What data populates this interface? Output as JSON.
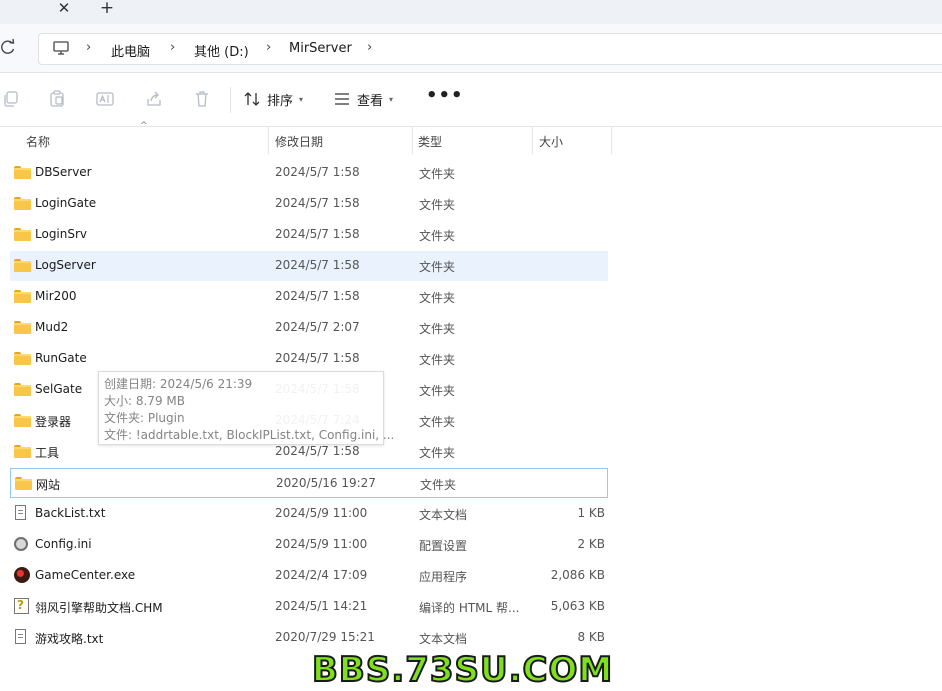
{
  "window": {
    "tab_close_glyph": "✕",
    "new_tab_glyph": "+"
  },
  "address": {
    "crumbs": [
      "此电脑",
      "其他 (D:)",
      "MirServer"
    ]
  },
  "toolbar": {
    "icons": [
      "copy-icon",
      "paste-icon",
      "rename-icon",
      "share-icon",
      "delete-icon"
    ],
    "sort_label": "排序",
    "view_label": "查看",
    "more_label": "•••"
  },
  "columns": {
    "name": "名称",
    "date": "修改日期",
    "type": "类型",
    "size": "大小"
  },
  "files": [
    {
      "name": "DBServer",
      "date": "2024/5/7 1:58",
      "type": "文件夹",
      "size": "",
      "icon": "folder-icon"
    },
    {
      "name": "LoginGate",
      "date": "2024/5/7 1:58",
      "type": "文件夹",
      "size": "",
      "icon": "folder-icon"
    },
    {
      "name": "LoginSrv",
      "date": "2024/5/7 1:58",
      "type": "文件夹",
      "size": "",
      "icon": "folder-icon"
    },
    {
      "name": "LogServer",
      "date": "2024/5/7 1:58",
      "type": "文件夹",
      "size": "",
      "icon": "folder-icon",
      "state": "hover"
    },
    {
      "name": "Mir200",
      "date": "2024/5/7 1:58",
      "type": "文件夹",
      "size": "",
      "icon": "folder-icon"
    },
    {
      "name": "Mud2",
      "date": "2024/5/7 2:07",
      "type": "文件夹",
      "size": "",
      "icon": "folder-icon"
    },
    {
      "name": "RunGate",
      "date": "2024/5/7 1:58",
      "type": "文件夹",
      "size": "",
      "icon": "folder-icon"
    },
    {
      "name": "SelGate",
      "date": "2024/5/7 1:58",
      "type": "文件夹",
      "size": "",
      "icon": "folder-icon"
    },
    {
      "name": "登录器",
      "date": "2024/5/7 7:24",
      "type": "文件夹",
      "size": "",
      "icon": "folder-icon"
    },
    {
      "name": "工具",
      "date": "2024/5/7 1:58",
      "type": "文件夹",
      "size": "",
      "icon": "folder-icon"
    },
    {
      "name": "网站",
      "date": "2020/5/16 19:27",
      "type": "文件夹",
      "size": "",
      "icon": "folder-icon",
      "state": "focus"
    },
    {
      "name": "BackList.txt",
      "date": "2024/5/9 11:00",
      "type": "文本文档",
      "size": "1 KB",
      "icon": "text-file-icon"
    },
    {
      "name": "Config.ini",
      "date": "2024/5/9 11:00",
      "type": "配置设置",
      "size": "2 KB",
      "icon": "settings-file-icon"
    },
    {
      "name": "GameCenter.exe",
      "date": "2024/2/4 17:09",
      "type": "应用程序",
      "size": "2,086 KB",
      "icon": "app-icon"
    },
    {
      "name": "翎风引擎帮助文档.CHM",
      "date": "2024/5/1 14:21",
      "type": "编译的 HTML 帮...",
      "size": "5,063 KB",
      "icon": "help-file-icon"
    },
    {
      "name": "游戏攻略.txt",
      "date": "2020/7/29 15:21",
      "type": "文本文档",
      "size": "8 KB",
      "icon": "text-file-icon"
    }
  ],
  "tooltip": {
    "created": "创建日期: 2024/5/6 21:39",
    "size": "大小: 8.79 MB",
    "folders": "文件夹: Plugin",
    "files": "文件: !addrtable.txt, BlockIPList.txt, Config.ini, ..."
  },
  "watermark": "BBS.73SU.COM",
  "colors": {
    "hover_row": "#e9f2fd",
    "focus_border": "#99c9ef",
    "folder": "#f8c74a",
    "watermark": "#7fe01c"
  }
}
